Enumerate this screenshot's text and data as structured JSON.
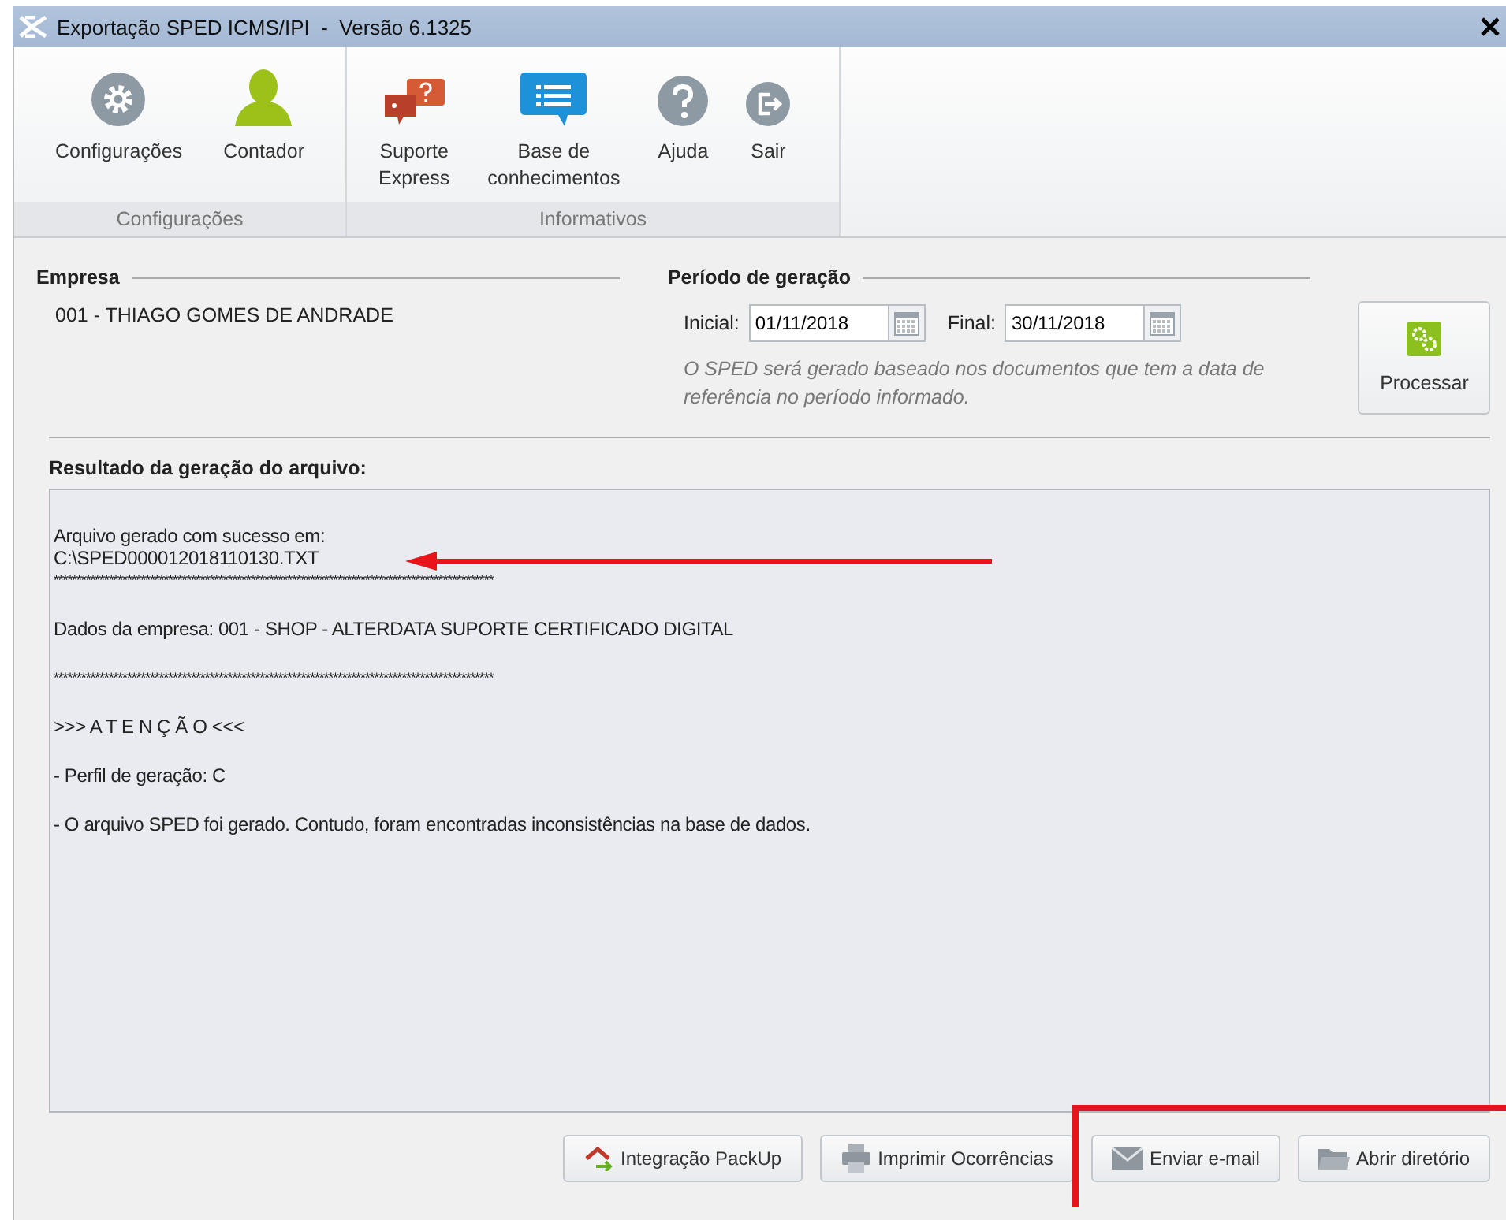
{
  "window": {
    "title": "Exportação SPED ICMS/IPI  -  Versão 6.1325"
  },
  "ribbon": [
    {
      "label": "Configurações",
      "items": [
        {
          "kind": "gear",
          "lines": [
            "Configurações"
          ]
        },
        {
          "kind": "person",
          "lines": [
            "Contador"
          ]
        }
      ]
    },
    {
      "label": "Informativos",
      "items": [
        {
          "kind": "support",
          "lines": [
            "Suporte",
            "Express"
          ]
        },
        {
          "kind": "knowledge",
          "lines": [
            "Base de",
            "conhecimentos"
          ]
        },
        {
          "kind": "help",
          "lines": [
            "Ajuda"
          ]
        },
        {
          "kind": "exit",
          "lines": [
            "Sair"
          ]
        }
      ]
    }
  ],
  "empresa": {
    "heading": "Empresa",
    "value": "001 - THIAGO GOMES DE ANDRADE"
  },
  "periodo": {
    "heading": "Período de geração",
    "start_label": "Inicial:",
    "start": "01/11/2018",
    "end_label": "Final:",
    "end": "30/11/2018",
    "note": "O SPED será gerado baseado nos documentos que tem a data de referência no período informado."
  },
  "process_button": "Processar",
  "result": {
    "heading": "Resultado da geração do arquivo:",
    "blocks": [
      [
        "Arquivo gerado com sucesso em:",
        "C:\\SPED000012018110130.TXT",
        "************************************************************************************************"
      ],
      [
        "Dados da empresa: 001 - SHOP - ALTERDATA SUPORTE CERTIFICADO DIGITAL"
      ],
      [
        "************************************************************************************************"
      ],
      [
        ">>> A T E N Ç Ã O <<<"
      ],
      [
        "- Perfil de geração: C"
      ],
      [
        "- O arquivo SPED foi gerado. Contudo, foram encontradas inconsistências na base de dados."
      ]
    ]
  },
  "buttons": [
    {
      "kind": "packup",
      "label": "Integração PackUp"
    },
    {
      "kind": "print",
      "label": "Imprimir Ocorrências"
    },
    {
      "kind": "mail",
      "label": "Enviar e-mail"
    },
    {
      "kind": "folder",
      "label": "Abrir diretório"
    }
  ]
}
